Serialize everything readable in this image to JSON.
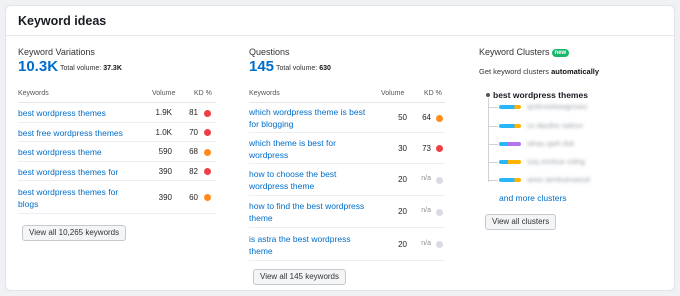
{
  "header": {
    "title": "Keyword ideas"
  },
  "variations": {
    "title": "Keyword Variations",
    "count": "10.3K",
    "total_label": "Total volume:",
    "total_value": "37.3K",
    "headers": {
      "keywords": "Keywords",
      "volume": "Volume",
      "kd": "KD %"
    },
    "rows": [
      {
        "keyword": "best wordpress themes",
        "volume": "1.9K",
        "kd": "81",
        "kd_color": "#f03e45"
      },
      {
        "keyword": "best free wordpress themes",
        "volume": "1.0K",
        "kd": "70",
        "kd_color": "#f03e45"
      },
      {
        "keyword": "best wordpress theme",
        "volume": "590",
        "kd": "68",
        "kd_color": "#ff8c1a"
      },
      {
        "keyword": "best wordpress themes for",
        "volume": "390",
        "kd": "82",
        "kd_color": "#f03e45"
      },
      {
        "keyword": "best wordpress themes for blogs",
        "volume": "390",
        "kd": "60",
        "kd_color": "#ff8c1a"
      }
    ],
    "button": "View all 10,265 keywords"
  },
  "questions": {
    "title": "Questions",
    "count": "145",
    "total_label": "Total volume:",
    "total_value": "630",
    "headers": {
      "keywords": "Keywords",
      "volume": "Volume",
      "kd": "KD %"
    },
    "rows": [
      {
        "keyword": "which wordpress theme is best for blogging",
        "volume": "50",
        "kd": "64",
        "kd_color": "#ff8c1a"
      },
      {
        "keyword": "which theme is best for wordpress",
        "volume": "30",
        "kd": "73",
        "kd_color": "#f03e45"
      },
      {
        "keyword": "how to choose the best wordpress theme",
        "volume": "20",
        "kd": "n/a",
        "kd_color": "#d9dbe0"
      },
      {
        "keyword": "how to find the best wordpress theme",
        "volume": "20",
        "kd": "n/a",
        "kd_color": "#d9dbe0"
      },
      {
        "keyword": "is astra the best wordpress theme",
        "volume": "20",
        "kd": "n/a",
        "kd_color": "#d9dbe0"
      }
    ],
    "button": "View all 145 keywords"
  },
  "clusters": {
    "title": "Keyword Clusters",
    "badge": "new",
    "subtitle_prefix": "Get keyword clusters",
    "subtitle_bold": "automatically",
    "root": "best wordpress themes",
    "items": [
      {
        "label": "qmknoslwwgnuwc",
        "colors": [
          "#29b6f6",
          "#29b6f6",
          "#ffb300"
        ]
      },
      {
        "label": "ss dauthe salexx",
        "colors": [
          "#29b6f6",
          "#29b6f6",
          "#ffb300"
        ]
      },
      {
        "label": "whau qwh dsk",
        "colors": [
          "#29b6f6",
          "#b374f0",
          "#b374f0"
        ]
      },
      {
        "label": "ssq xonkue cidng",
        "colors": [
          "#29b6f6",
          "#ffb300",
          "#ffb300"
        ]
      },
      {
        "label": "aeex aenkuesaxud",
        "colors": [
          "#29b6f6",
          "#29b6f6",
          "#ffb300"
        ]
      }
    ],
    "more": "and more clusters",
    "button": "View all clusters"
  }
}
